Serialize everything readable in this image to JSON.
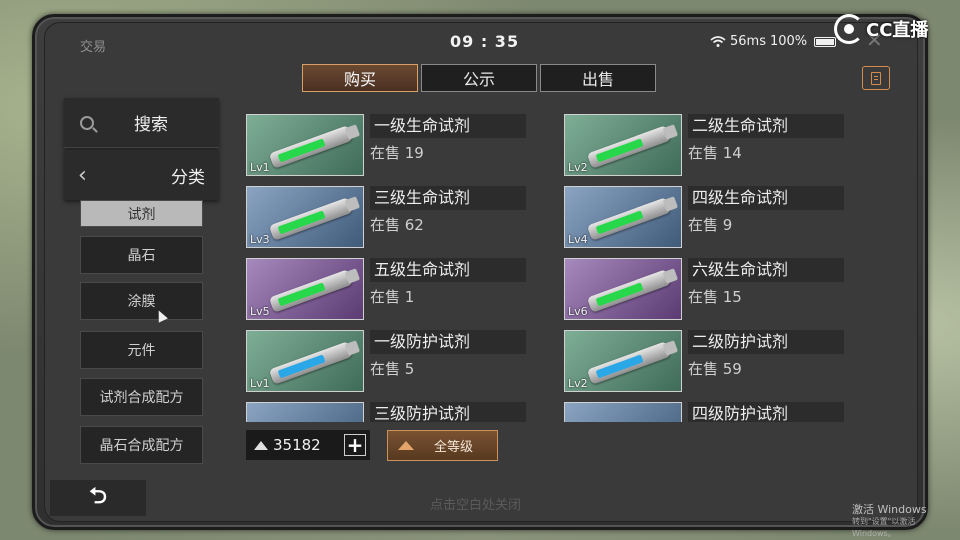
{
  "status_bar": {
    "title": "交易",
    "clock": "09 : 35",
    "ping": "56ms",
    "battery": "100%"
  },
  "overlay": {
    "brand": "CC直播"
  },
  "tabs": [
    {
      "label": "购买",
      "active": true
    },
    {
      "label": "公示",
      "active": false
    },
    {
      "label": "出售",
      "active": false
    }
  ],
  "sidebar": {
    "search_label": "搜索",
    "category_label": "分类",
    "items": [
      {
        "label": "试剂",
        "selected": true
      },
      {
        "label": "晶石"
      },
      {
        "label": "涂膜"
      },
      {
        "label": "元件"
      },
      {
        "label": "试剂合成配方"
      },
      {
        "label": "晶石合成配方"
      }
    ]
  },
  "items": [
    {
      "name": "一级生命试剂",
      "stock": "在售 19",
      "level": "Lv1",
      "color": "green",
      "fluid": "#27d84a"
    },
    {
      "name": "二级生命试剂",
      "stock": "在售 14",
      "level": "Lv2",
      "color": "green",
      "fluid": "#27d84a"
    },
    {
      "name": "三级生命试剂",
      "stock": "在售 62",
      "level": "Lv3",
      "color": "blue",
      "fluid": "#27d84a"
    },
    {
      "name": "四级生命试剂",
      "stock": "在售 9",
      "level": "Lv4",
      "color": "blue",
      "fluid": "#27d84a"
    },
    {
      "name": "五级生命试剂",
      "stock": "在售 1",
      "level": "Lv5",
      "color": "purple",
      "fluid": "#27d84a"
    },
    {
      "name": "六级生命试剂",
      "stock": "在售 15",
      "level": "Lv6",
      "color": "purple",
      "fluid": "#27d84a"
    },
    {
      "name": "一级防护试剂",
      "stock": "在售 5",
      "level": "Lv1",
      "color": "green",
      "fluid": "#2aa7e6"
    },
    {
      "name": "二级防护试剂",
      "stock": "在售 59",
      "level": "Lv2",
      "color": "green",
      "fluid": "#2aa7e6"
    },
    {
      "name": "三级防护试剂",
      "stock": "",
      "level": "",
      "color": "blue",
      "fluid": "#2aa7e6"
    },
    {
      "name": "四级防护试剂",
      "stock": "",
      "level": "",
      "color": "blue",
      "fluid": "#2aa7e6"
    }
  ],
  "footer": {
    "currency": "35182",
    "filter_label": "全等级",
    "hint": "点击空白处关闭"
  },
  "watermark": {
    "line1": "激活 Windows",
    "line2": "转到\"设置\"以激活 Windows。"
  }
}
